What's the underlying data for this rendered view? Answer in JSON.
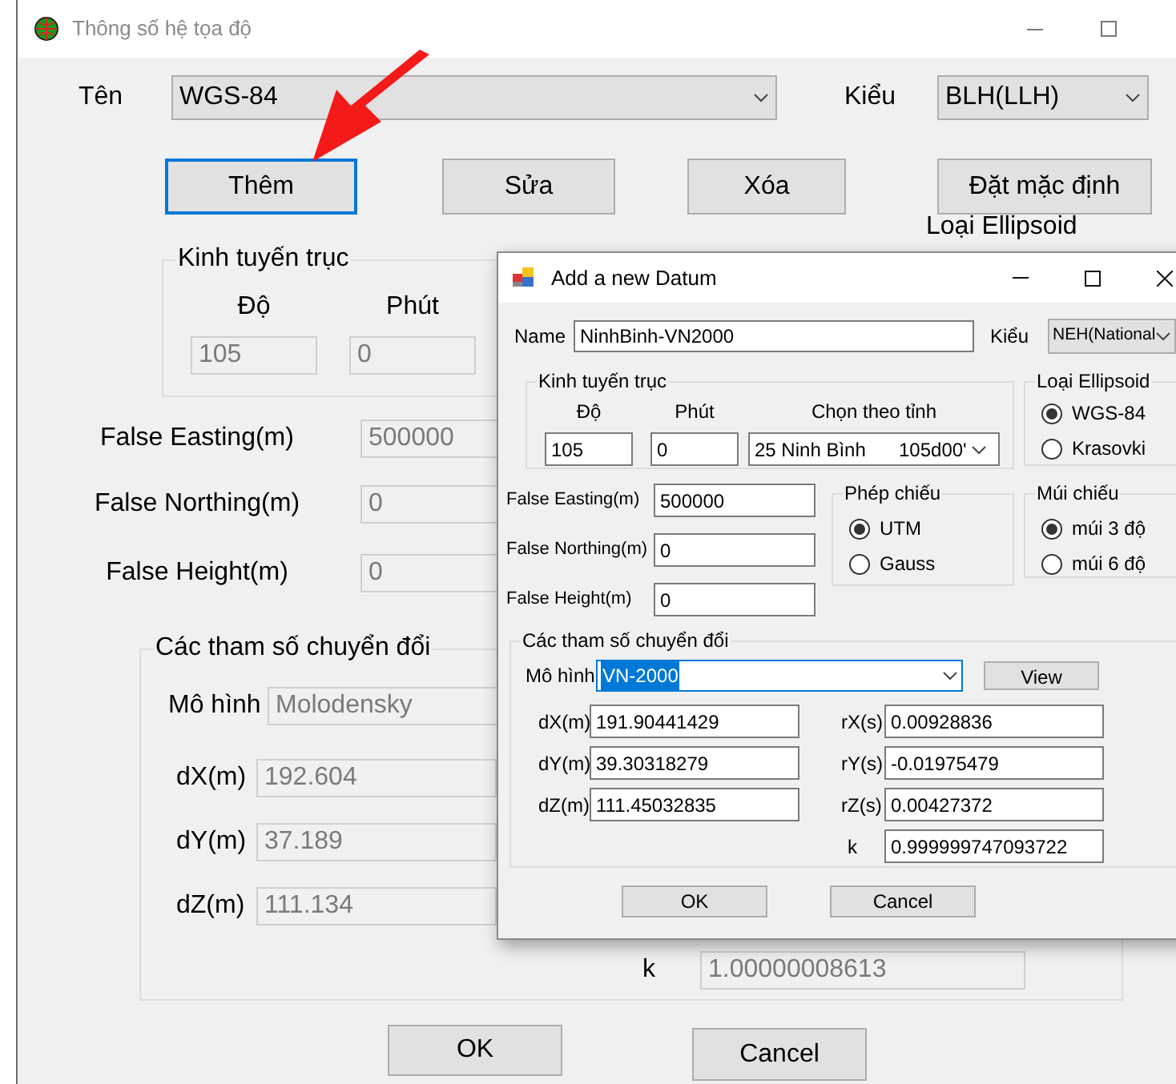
{
  "main_window": {
    "title": "Thông số hệ tọa độ",
    "fields_disabled": true,
    "name_label": "Tên",
    "name_combo": "WGS-84",
    "type_label": "Kiểu",
    "type_combo": "BLH(LLH)",
    "buttons": [
      {
        "label": "Thêm",
        "focused": true
      },
      {
        "label": "Sửa",
        "focused": false
      },
      {
        "label": "Xóa",
        "focused": false
      },
      {
        "label": "Đặt mặc định",
        "focused": false
      }
    ],
    "central_meridian": {
      "title": "Kinh tuyến trục",
      "degree_label": "Độ",
      "minute_label": "Phút",
      "degree": "105",
      "minute": "0"
    },
    "ellipsoid_title": "Loại Ellipsoid",
    "offsets": [
      {
        "label": "False Easting(m)",
        "value": "500000"
      },
      {
        "label": "False Northing(m)",
        "value": "0"
      },
      {
        "label": "False Height(m)",
        "value": "0"
      }
    ],
    "transform": {
      "title": "Các tham số chuyển đổi",
      "model_label": "Mô hình",
      "model": "Molodensky",
      "shifts": [
        {
          "label": "dX(m)",
          "value": "192.604"
        },
        {
          "label": "dY(m)",
          "value": "37.189"
        },
        {
          "label": "dZ(m)",
          "value": "111.134"
        }
      ],
      "k_label": "k",
      "k": "1.00000008613"
    },
    "footer_buttons": [
      "OK",
      "Cancel"
    ]
  },
  "dialog": {
    "title": "Add a new Datum",
    "name_label": "Name",
    "name_value": "NinhBinh-VN2000",
    "type_label": "Kiểu",
    "type_combo": "NEH(National",
    "central_meridian": {
      "title": "Kinh tuyến trục",
      "degree_label": "Độ",
      "minute_label": "Phút",
      "province_label": "Chọn theo tỉnh",
      "degree": "105",
      "minute": "0",
      "province": "25 Ninh Bình",
      "province_meridian": "105d00'"
    },
    "ellipsoid": {
      "title": "Loại Ellipsoid",
      "options": [
        {
          "label": "WGS-84",
          "selected": true
        },
        {
          "label": "Krasovki",
          "selected": false
        }
      ]
    },
    "offsets": [
      {
        "label": "False Easting(m)",
        "value": "500000"
      },
      {
        "label": "False Northing(m)",
        "value": "0"
      },
      {
        "label": "False Height(m)",
        "value": "0"
      }
    ],
    "projection": {
      "title": "Phép chiếu",
      "options": [
        {
          "label": "UTM",
          "selected": true
        },
        {
          "label": "Gauss",
          "selected": false
        }
      ]
    },
    "zone": {
      "title": "Múi chiếu",
      "options": [
        {
          "label": "múi 3 độ",
          "selected": true
        },
        {
          "label": "múi 6 độ",
          "selected": false
        }
      ]
    },
    "transform": {
      "title": "Các tham số chuyển đổi",
      "model_label": "Mô hình",
      "model": "VN-2000",
      "model_text_selected": true,
      "view_button": "View",
      "shifts": [
        {
          "label": "dX(m)",
          "value": "191.90441429"
        },
        {
          "label": "dY(m)",
          "value": "39.30318279"
        },
        {
          "label": "dZ(m)",
          "value": "111.45032835"
        }
      ],
      "rotations": [
        {
          "label": "rX(s)",
          "value": "0.00928836"
        },
        {
          "label": "rY(s)",
          "value": "-0.01975479"
        },
        {
          "label": "rZ(s)",
          "value": "0.00427372"
        },
        {
          "label": "k",
          "value": "0.999999747093722"
        }
      ]
    },
    "footer_buttons": [
      "OK",
      "Cancel"
    ]
  }
}
